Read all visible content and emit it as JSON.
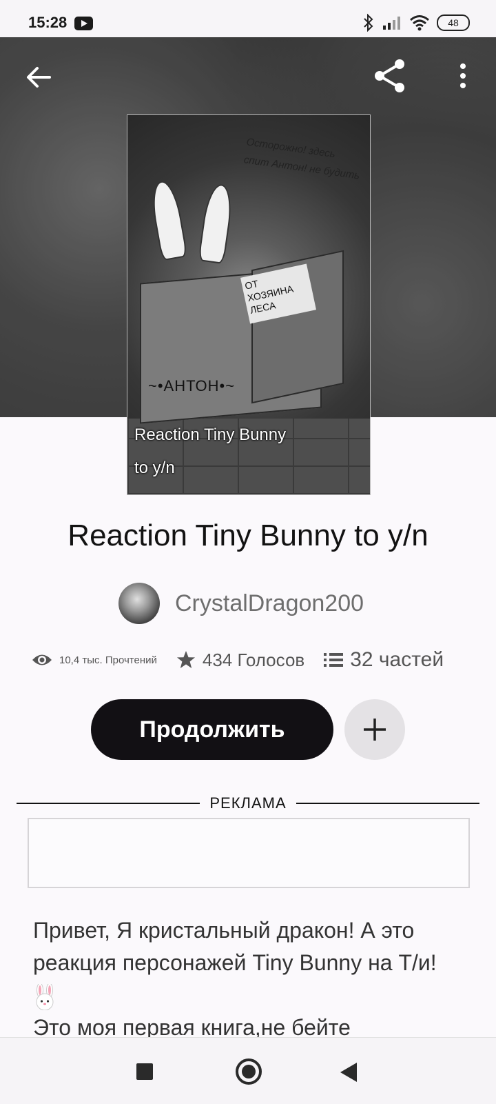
{
  "status_bar": {
    "time": "15:28",
    "battery": "48"
  },
  "header": {
    "back_icon": "arrow-left-icon",
    "share_icon": "share-icon",
    "more_icon": "more-vertical-icon"
  },
  "cover": {
    "title_line1": "Reaction Tiny Bunny",
    "title_line2": "to y/n",
    "handwritten_note": "Осторожно! здесь спит Антон! не будить",
    "box_label": "ОТ ХОЗЯИНА ЛЕСА",
    "box_name": "~•АНТОН•~"
  },
  "story": {
    "title": "Reaction Tiny Bunny to y/n",
    "author": "CrystalDragon200",
    "reads": "10,4 тыс. Прочтений",
    "votes": "434 Голосов",
    "parts": "32 частей"
  },
  "actions": {
    "continue_label": "Продолжить",
    "add_icon": "plus-icon"
  },
  "ad": {
    "label": "РЕКЛАМА"
  },
  "description": {
    "line1": "Привет, Я кристальный дракон! А это реакция персонажей Tiny Bunny на Т/и!",
    "line2": " Это моя первая книга,не бейте"
  },
  "navbar": {
    "square_icon": "recent-apps-icon",
    "home_icon": "home-icon",
    "back_icon": "back-triangle-icon"
  }
}
